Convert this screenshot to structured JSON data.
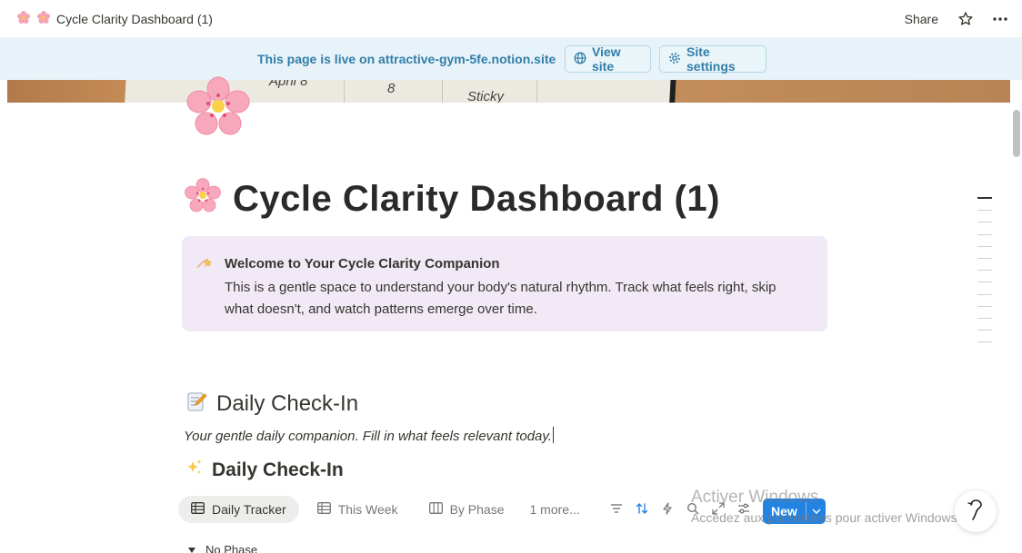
{
  "topbar": {
    "breadcrumb_title": "Cycle Clarity Dashboard (1)",
    "share_label": "Share",
    "icons": [
      "cherry-blossom-icon",
      "star-icon",
      "more-icon"
    ]
  },
  "banner": {
    "message": "This page is live on attractive-gym-5fe.notion.site",
    "view_site_label": "View site",
    "site_settings_label": "Site settings"
  },
  "cover": {
    "visible_text": [
      "April 8",
      "8",
      "Sticky"
    ]
  },
  "page": {
    "title": "Cycle Clarity Dashboard (1)"
  },
  "callout": {
    "title": "Welcome to Your Cycle Clarity Companion",
    "body": "This is a gentle space to understand your body's natural rhythm. Track what feels right, skip what doesn't, and watch patterns emerge over time."
  },
  "section": {
    "heading": "Daily Check-In",
    "subtext": "Your gentle daily companion. Fill in what feels relevant today."
  },
  "database": {
    "heading": "Daily Check-In",
    "tabs": [
      {
        "label": "Daily Tracker"
      },
      {
        "label": "This Week"
      },
      {
        "label": "By Phase"
      }
    ],
    "more_label": "1 more...",
    "new_label": "New",
    "group_label": "No Phase"
  },
  "watermark": {
    "title": "Activer Windows",
    "subtitle": "Accédez aux paramètres pour activer Windows."
  },
  "colors": {
    "banner_bg": "#e7f3f8",
    "banner_text": "#337ea9",
    "callout_bg": "#f1e9f6",
    "accent_blue": "#2383e2"
  }
}
